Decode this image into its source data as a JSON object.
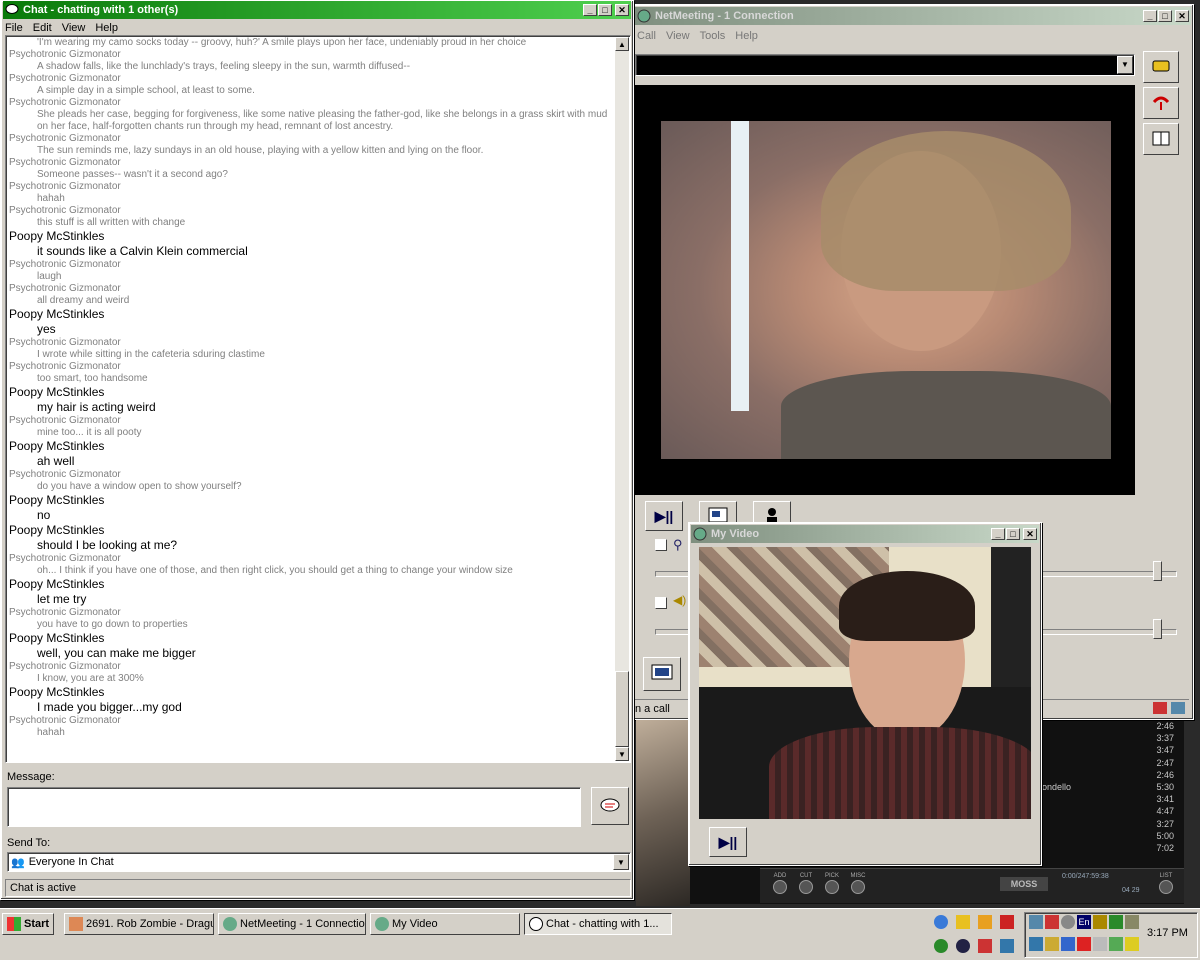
{
  "chat_window": {
    "title": "Chat - chatting with 1 other(s)",
    "menu": [
      "File",
      "Edit",
      "View",
      "Help"
    ],
    "first_line": "'I'm wearing my camo socks today -- groovy, huh?'  A smile plays upon her face, undeniably proud in her choice",
    "messages": [
      {
        "sender": "Psychotronic Gizmonator",
        "text": "A shadow falls, like the lunchlady's trays, feeling sleepy in the sun, warmth diffused--",
        "style": "a"
      },
      {
        "sender": "Psychotronic Gizmonator",
        "text": "A simple day in a simple school, at least to some.",
        "style": "a"
      },
      {
        "sender": "Psychotronic Gizmonator",
        "text": "She pleads her case, begging for forgiveness, like some native pleasing the father-god, like she belongs in a grass skirt with mud",
        "text2": "on her face, half-forgotten chants run through my head, remnant of lost ancestry.",
        "style": "a"
      },
      {
        "sender": "Psychotronic Gizmonator",
        "text": "The sun reminds me, lazy sundays in an old house, playing with a yellow kitten and lying on the floor.",
        "style": "a"
      },
      {
        "sender": "Psychotronic Gizmonator",
        "text": "Someone passes-- wasn't it a second ago?",
        "style": "a"
      },
      {
        "sender": "Psychotronic Gizmonator",
        "text": "hahah",
        "style": "a"
      },
      {
        "sender": "Psychotronic Gizmonator",
        "text": "this stuff is all written with change",
        "style": "a"
      },
      {
        "sender": "Poopy McStinkles",
        "text": "it sounds like a Calvin Klein commercial",
        "style": "b"
      },
      {
        "sender": "Psychotronic Gizmonator",
        "text": "laugh",
        "style": "a"
      },
      {
        "sender": "Psychotronic Gizmonator",
        "text": "all dreamy and weird",
        "style": "a"
      },
      {
        "sender": "Poopy McStinkles",
        "text": "yes",
        "style": "b"
      },
      {
        "sender": "Psychotronic Gizmonator",
        "text": "I wrote while sitting in the cafeteria sduring clastime",
        "style": "a"
      },
      {
        "sender": "Psychotronic Gizmonator",
        "text": "too smart, too handsome",
        "style": "a"
      },
      {
        "sender": "Poopy McStinkles",
        "text": "my hair is acting weird",
        "style": "b"
      },
      {
        "sender": "Psychotronic Gizmonator",
        "text": "mine too... it is all pooty",
        "style": "a"
      },
      {
        "sender": "Poopy McStinkles",
        "text": "ah well",
        "style": "b"
      },
      {
        "sender": "Psychotronic Gizmonator",
        "text": "do you have a window open to show yourself?",
        "style": "a"
      },
      {
        "sender": "Poopy McStinkles",
        "text": "no",
        "style": "b"
      },
      {
        "sender": "Poopy McStinkles",
        "text": "should I be looking at me?",
        "style": "b"
      },
      {
        "sender": "Psychotronic Gizmonator",
        "text": "oh... I think if you have one of those, and then right click, you should get a thing to change your window size",
        "style": "a"
      },
      {
        "sender": "Poopy McStinkles",
        "text": "let me try",
        "style": "b"
      },
      {
        "sender": "Psychotronic Gizmonator",
        "text": "you have to go down to properties",
        "style": "a"
      },
      {
        "sender": "Poopy McStinkles",
        "text": "well, you can make me bigger",
        "style": "b"
      },
      {
        "sender": "Psychotronic Gizmonator",
        "text": "I know, you are at 300%",
        "style": "a"
      },
      {
        "sender": "Poopy McStinkles",
        "text": "I made you bigger...my god",
        "style": "b"
      },
      {
        "sender": "Psychotronic Gizmonator",
        "text": "hahah",
        "style": "a"
      }
    ],
    "message_label": "Message:",
    "message_value": "",
    "send_to_label": "Send To:",
    "send_to_value": "Everyone In Chat",
    "status": "Chat is active"
  },
  "netmeeting": {
    "title": "NetMeeting - 1 Connection",
    "menu": [
      "Call",
      "View",
      "Tools",
      "Help"
    ],
    "status_partial": "n a call"
  },
  "my_video": {
    "title": "My Video"
  },
  "player": {
    "times": [
      "2:46",
      "3:37",
      "3:47",
      "2:47",
      "2:46",
      "5:30",
      "3:41",
      "4:47",
      "3:27",
      "5:00",
      "7:02"
    ],
    "track_partial": "ondello",
    "buttons": [
      "ADD",
      "CUT",
      "PICK",
      "MISC",
      "LIST"
    ],
    "brand": "MOSS",
    "time_readout": "0:00/247:59:38",
    "counter": "04 29"
  },
  "taskbar": {
    "start_label": "Start",
    "items": [
      {
        "label": "2691. Rob Zombie - Dragu..."
      },
      {
        "label": "NetMeeting - 1 Connection"
      },
      {
        "label": "My Video"
      },
      {
        "label": "Chat - chatting with 1..."
      }
    ],
    "clock": "3:17 PM",
    "lang": "En"
  }
}
